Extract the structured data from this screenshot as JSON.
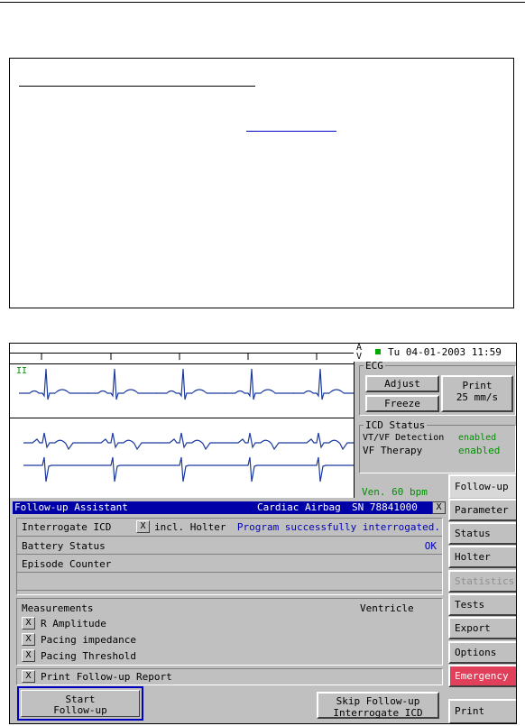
{
  "status": {
    "av_label": "A V",
    "datetime": "Tu 04-01-2003 11:59"
  },
  "ecg": {
    "lead_label": "II",
    "legend": "ECG",
    "adjust": "Adjust",
    "freeze": "Freeze",
    "print_line1": "Print",
    "print_line2": "25 mm/s"
  },
  "icd_status": {
    "legend": "ICD Status",
    "rows": [
      {
        "label": "VT/VF Detection",
        "value": "enabled"
      },
      {
        "label": "VF Therapy",
        "value": "enabled"
      }
    ],
    "ven_rate": "Ven. 60 bpm"
  },
  "sidebar": {
    "items": [
      {
        "label": "Follow-up",
        "state": "active"
      },
      {
        "label": "Parameter",
        "state": "normal"
      },
      {
        "label": "Status",
        "state": "normal"
      },
      {
        "label": "Holter",
        "state": "normal"
      },
      {
        "label": "Statistics",
        "state": "disabled"
      },
      {
        "label": "Tests",
        "state": "normal"
      },
      {
        "label": "Export",
        "state": "normal"
      },
      {
        "label": "Options",
        "state": "normal"
      },
      {
        "label": "Emergency",
        "state": "emergency"
      },
      {
        "label": "Print",
        "state": "normal"
      }
    ]
  },
  "assistant": {
    "title": "Follow-up Assistant",
    "device": "Cardiac Airbag",
    "serial": "SN 78841000",
    "close": "X",
    "interrogate_label": "Interrogate ICD",
    "holter_check": "X",
    "holter_label": "incl. Holter",
    "interrogate_msg": "Program successfully interrogated.",
    "battery_label": "Battery Status",
    "battery_value": "OK",
    "episode_label": "Episode Counter",
    "measurements_label": "Measurements",
    "ventricle_label": "Ventricle",
    "measurements": [
      {
        "check": "X",
        "label": "R Amplitude"
      },
      {
        "check": "X",
        "label": "Pacing impedance"
      },
      {
        "check": "X",
        "label": "Pacing Threshold"
      }
    ],
    "report_check": "X",
    "report_label": "Print Follow-up Report",
    "start_line1": "Start",
    "start_line2": "Follow-up",
    "skip_line1": "Skip Follow-up",
    "skip_line2": "Interrogate ICD"
  }
}
